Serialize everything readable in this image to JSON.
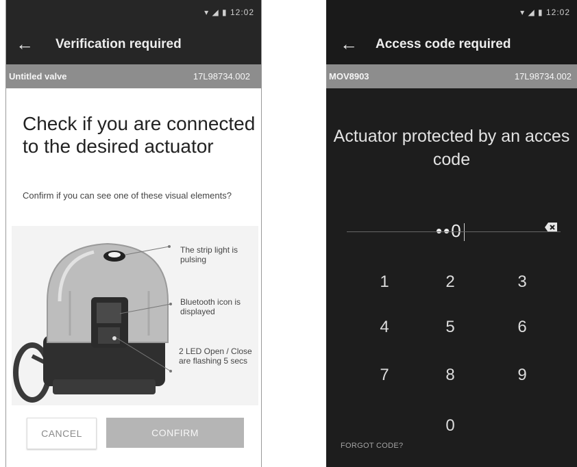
{
  "left": {
    "status_time": "12:02",
    "title": "Verification required",
    "device_name": "Untitled valve",
    "device_id": "17L98734.002",
    "heading": "Check if you are connected to the desired actuator",
    "prompt": "Confirm if you can see one of these visual elements?",
    "callouts": [
      "The strip light is pulsing",
      "Bluetooth icon is displayed",
      "2 LED Open / Close are flashing 5 secs"
    ],
    "cancel_label": "CANCEL",
    "confirm_label": "CONFIRM"
  },
  "right": {
    "status_time": "12:02",
    "title": "Access code required",
    "device_name": "MOV8903",
    "device_id": "17L98734.002",
    "heading": "Actuator protected by an acces code",
    "pin_masked": "••",
    "pin_last": "0",
    "keys": [
      "1",
      "2",
      "3",
      "4",
      "5",
      "6",
      "7",
      "8",
      "9",
      "0"
    ],
    "forgot_label": "FORGOT CODE?"
  }
}
